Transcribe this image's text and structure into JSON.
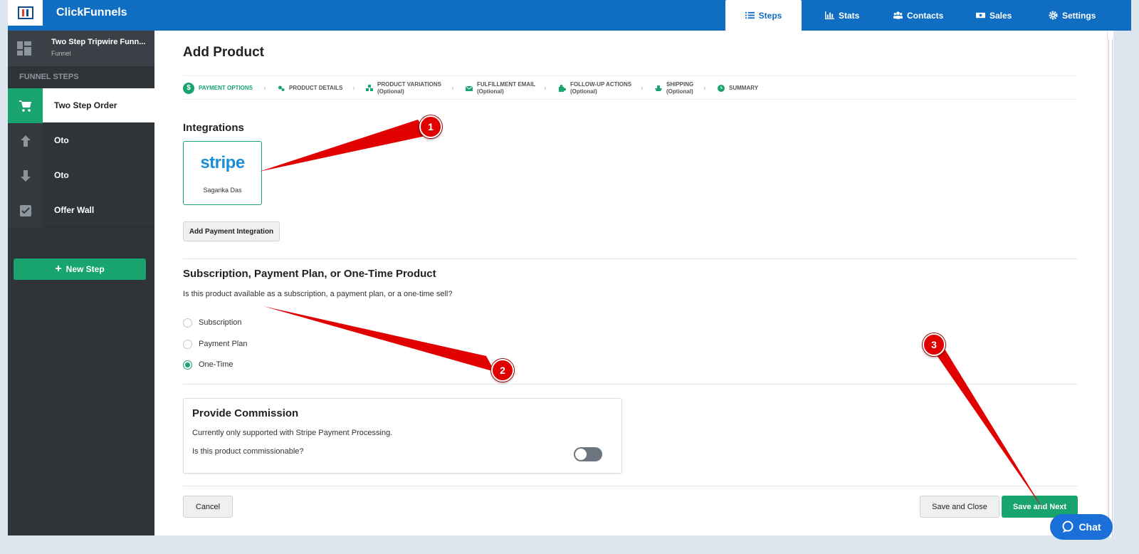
{
  "app": {
    "brand": "ClickFunnels"
  },
  "nav": {
    "tabs": [
      {
        "label": "Steps",
        "icon": "list-icon",
        "active": true
      },
      {
        "label": "Stats",
        "icon": "bar-chart-icon"
      },
      {
        "label": "Contacts",
        "icon": "users-icon"
      },
      {
        "label": "Sales",
        "icon": "money-icon"
      },
      {
        "label": "Settings",
        "icon": "gear-icon"
      }
    ]
  },
  "sidebar": {
    "funnel_name": "Two Step Tripwire Funn...",
    "funnel_type": "Funnel",
    "section_label": "FUNNEL STEPS",
    "steps": [
      {
        "label": "Two Step Order",
        "icon": "cart-icon",
        "active": true
      },
      {
        "label": "Oto",
        "icon": "arrow-up-icon"
      },
      {
        "label": "Oto",
        "icon": "arrow-down-icon"
      },
      {
        "label": "Offer Wall",
        "icon": "checkbox-icon"
      }
    ],
    "new_step_label": "New Step"
  },
  "main": {
    "title": "Add Product",
    "wizard": [
      {
        "label": "PAYMENT OPTIONS",
        "sub": "",
        "icon": "dollar-icon",
        "active": true
      },
      {
        "label": "PRODUCT DETAILS",
        "sub": "",
        "icon": "gears-icon"
      },
      {
        "label": "PRODUCT VARIATIONS",
        "sub": "(Optional)",
        "icon": "cubes-icon"
      },
      {
        "label": "FULFILLMENT EMAIL",
        "sub": "(Optional)",
        "icon": "envelope-icon"
      },
      {
        "label": "FOLLOW-UP ACTIONS",
        "sub": "(Optional)",
        "icon": "puzzle-icon"
      },
      {
        "label": "SHIPPING",
        "sub": "(Optional)",
        "icon": "ship-icon"
      },
      {
        "label": "SUMMARY",
        "sub": "",
        "icon": "clock-icon"
      }
    ],
    "integrations": {
      "title": "Integrations",
      "card_logo": "stripe",
      "card_user": "Sagarika Das",
      "add_button": "Add Payment Integration"
    },
    "product_type": {
      "title": "Subscription, Payment Plan, or One-Time Product",
      "question": "Is this product available as a subscription, a payment plan, or a one-time sell?",
      "options": [
        {
          "label": "Subscription",
          "selected": false
        },
        {
          "label": "Payment Plan",
          "selected": false
        },
        {
          "label": "One-Time",
          "selected": true
        }
      ]
    },
    "commission": {
      "title": "Provide Commission",
      "note": "Currently only supported with Stripe Payment Processing.",
      "question": "Is this product commissionable?",
      "enabled": false
    },
    "actions": {
      "cancel": "Cancel",
      "save_close": "Save and Close",
      "save_next": "Save and Next"
    }
  },
  "chat": {
    "label": "Chat"
  },
  "annotations": [
    {
      "number": "1"
    },
    {
      "number": "2"
    },
    {
      "number": "3"
    }
  ],
  "colors": {
    "brand_blue": "#0f6ec2",
    "accent_green": "#18a36f",
    "sidebar_dark": "#2f3438",
    "annotation_red": "#e00000",
    "chat_blue": "#1a6fd8"
  }
}
